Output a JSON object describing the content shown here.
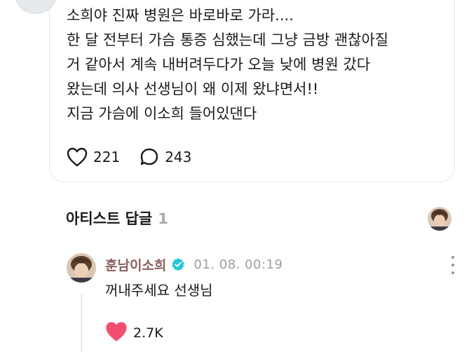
{
  "post": {
    "text": "소희야 진짜 병원은 바로바로 가라....\n한 달 전부터 가슴 통증 심했는데 그냥 금방 괜찮아질\n거 같아서 계속 내버려두다가 오늘 낮에 병원 갔다\n왔는데 의사 선생님이 왜 이제 왔냐면서!!\n지금 가슴에 이소희 들어있댄다",
    "like_count": "221",
    "comment_count": "243"
  },
  "artist_replies": {
    "title": "아티스트 답글",
    "count": "1"
  },
  "reply": {
    "author": "훈남이소희",
    "timestamp": "01. 08. 00:19",
    "text": "꺼내주세요 선생님",
    "like_count": "2.7K"
  },
  "colors": {
    "heart_filled": "#f0506e",
    "verified_badge": "#21c5d6",
    "author_name": "#8a5e5e"
  },
  "icons": {
    "like": "heart-outline-icon",
    "comment": "speech-bubble-icon",
    "verified": "verified-badge-icon",
    "more": "vertical-dots-icon",
    "reply_like": "heart-filled-icon"
  }
}
